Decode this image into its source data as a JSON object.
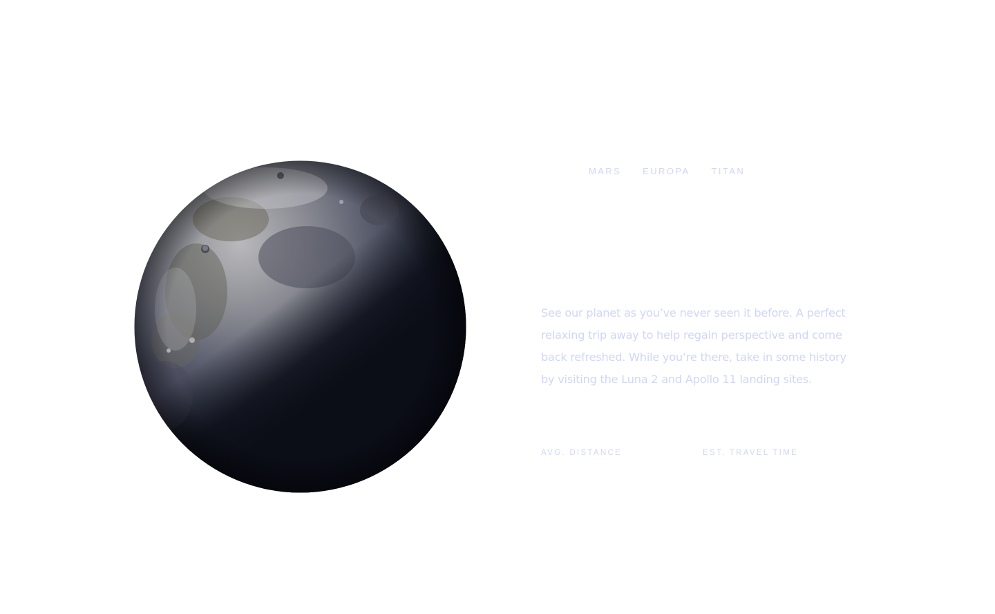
{
  "tabs": [
    {
      "label": "MARS"
    },
    {
      "label": "EUROPA"
    },
    {
      "label": "TITAN"
    }
  ],
  "description": "See our planet as you’ve never seen it before. A perfect relaxing trip away to help regain perspective and come back refreshed. While you’re there, take in some history by visiting the Luna 2 and Apollo 11 landing sites.",
  "stats": {
    "distance_label": "AVG. DISTANCE",
    "travel_label": "EST. TRAVEL TIME"
  },
  "colors": {
    "text_light": "#d0d6f9",
    "background": "#ffffff",
    "planet_dark": "#0b0d17"
  }
}
